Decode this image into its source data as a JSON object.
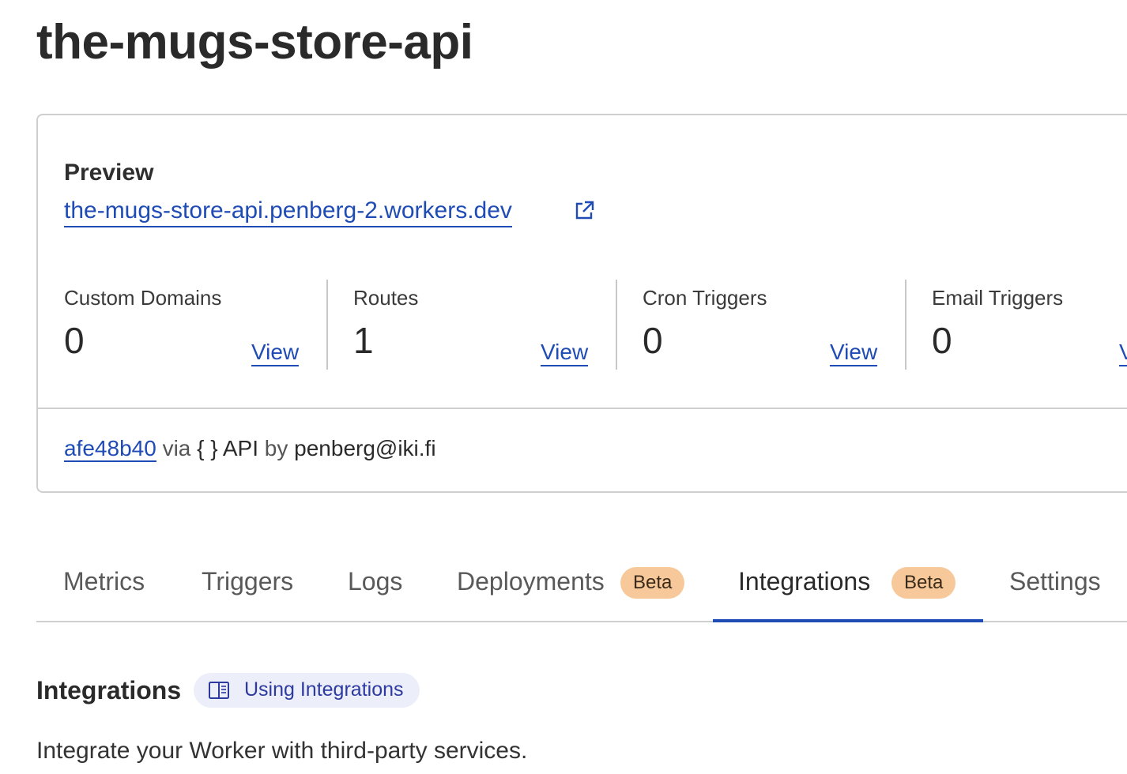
{
  "worker": {
    "title": "the-mugs-store-api"
  },
  "preview": {
    "label": "Preview",
    "url_text": "the-mugs-store-api.penberg-2.workers.dev",
    "external_icon": "external-link-icon"
  },
  "stats": [
    {
      "label": "Custom Domains",
      "value": "0",
      "view": "View"
    },
    {
      "label": "Routes",
      "value": "1",
      "view": "View"
    },
    {
      "label": "Cron Triggers",
      "value": "0",
      "view": "View"
    },
    {
      "label": "Email Triggers",
      "value": "0",
      "view": "View"
    }
  ],
  "deployment": {
    "hash": "afe48b40",
    "via": "via",
    "source_icon": "{ }",
    "source": "API",
    "by": "by",
    "author": "penberg@iki.fi"
  },
  "tabs": [
    {
      "label": "Metrics"
    },
    {
      "label": "Triggers"
    },
    {
      "label": "Logs"
    },
    {
      "label": "Deployments",
      "badge": "Beta"
    },
    {
      "label": "Integrations",
      "badge": "Beta",
      "active": true
    },
    {
      "label": "Settings"
    }
  ],
  "integrations": {
    "title": "Integrations",
    "doc_link": "Using Integrations",
    "doc_icon": "book-icon",
    "description": "Integrate your Worker with third-party services."
  },
  "colors": {
    "link": "#1f4bb5",
    "badge_bg": "#f7c99a",
    "pill_bg": "#eceefa",
    "tab_active_underline": "#1f4bb5"
  }
}
